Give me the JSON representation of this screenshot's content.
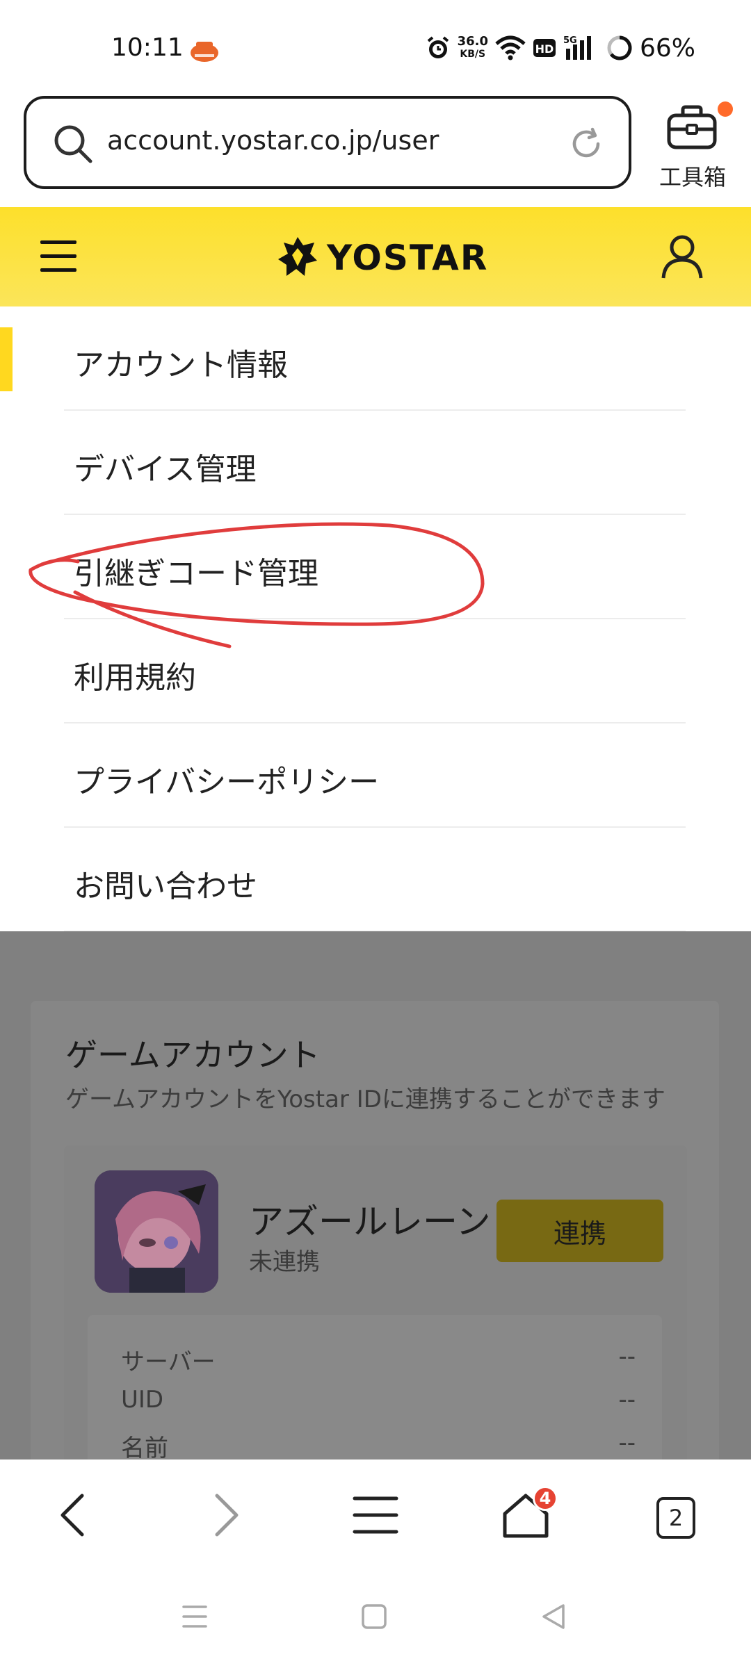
{
  "status_bar": {
    "time": "10:11",
    "speed_value": "36.0",
    "speed_unit": "KB/S",
    "battery": "66%",
    "icons": [
      "alarm-icon",
      "wifi-icon",
      "hd-icon",
      "5g-signal-icon",
      "battery-icon"
    ]
  },
  "url_bar": {
    "url": "account.yostar.co.jp/user",
    "toolbox_label": "工具箱"
  },
  "site_header": {
    "logo_text": "YOSTAR",
    "accent_color": "#fde02b"
  },
  "menu": {
    "items": [
      {
        "label": "アカウント情報",
        "active": true
      },
      {
        "label": "デバイス管理"
      },
      {
        "label": "引継ぎコード管理"
      },
      {
        "label": "利用規約"
      },
      {
        "label": "プライバシーポリシー"
      },
      {
        "label": "お問い合わせ"
      }
    ]
  },
  "game_section": {
    "title": "ゲームアカウント",
    "subtitle": "ゲームアカウントをYostar IDに連携することができます",
    "game_name": "アズールレーン",
    "game_status": "未連携",
    "link_button": "連携",
    "info": [
      {
        "label": "サーバー",
        "value": "--"
      },
      {
        "label": "UID",
        "value": "--"
      },
      {
        "label": "名前",
        "value": "--"
      }
    ]
  },
  "browser_nav": {
    "home_badge": "4",
    "tab_count": "2"
  }
}
